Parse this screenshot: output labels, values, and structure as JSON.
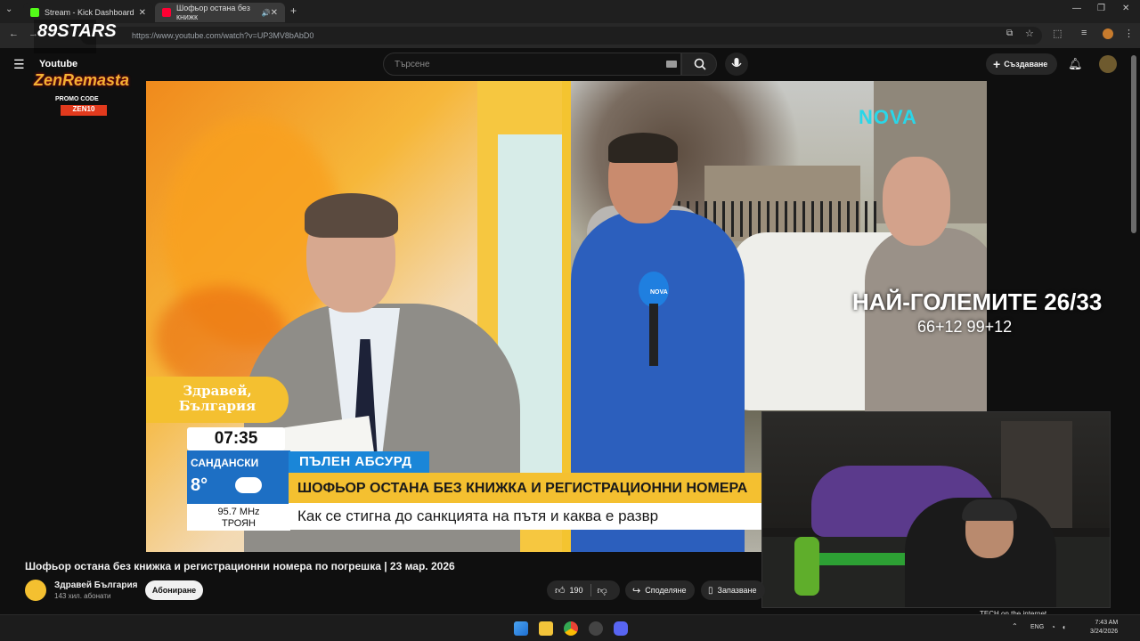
{
  "browser": {
    "tabs": [
      {
        "label": "Stream - Kick Dashboard",
        "icon": "kick-icon",
        "color": "#53fc18"
      },
      {
        "label": "Шофьор остана без книжк",
        "icon": "youtube-icon",
        "color": "#ff0033"
      }
    ],
    "url": "https://www.youtube.com/watch?v=UP3MV8bAbD0"
  },
  "youtube": {
    "search_placeholder": "Търсене",
    "create_label": "Създаване"
  },
  "broadcast": {
    "network_logo": "NOVA",
    "mic_label": "NOVA",
    "show_logo_line1": "Здравей,",
    "show_logo_line2": "България",
    "clock": "07:35",
    "city": "САНДАНСКИ",
    "temperature": "8°",
    "radio_freq": "95.7 MHz",
    "radio_city": "ТРОЯН",
    "tag": "ПЪЛЕН АБСУРД",
    "headline": "ШОФЬОР ОСТАНА БЕЗ КНИЖКА И РЕГИСТРАЦИОННИ НОМЕРА",
    "subline": "Как се стигна до санкцията на пътя и каква е развр"
  },
  "overlay": {
    "stars": "89STARS",
    "youtube_brand": "Youtube",
    "zen": "ZenRemasta",
    "promo": "PROMO CODE",
    "promo_code": "ZEN10",
    "big_text": "НАЙ-ГОЛЕМИТЕ 26/33",
    "small_text": "66+12 99+12",
    "webcam_caption": "TECH on the internet"
  },
  "video_meta": {
    "title": "Шофьор остана без книжка и регистрационни номера по погрешка | 23 мар. 2026",
    "channel": "Здравей България",
    "subscribers": "143 хил. абонати",
    "subscribe_label": "Абониране",
    "likes": "190",
    "share_label": "Споделяне",
    "save_label": "Запазване"
  },
  "taskbar": {
    "lang": "ENG",
    "time": "7:43 AM",
    "date": "3/24/2026"
  }
}
